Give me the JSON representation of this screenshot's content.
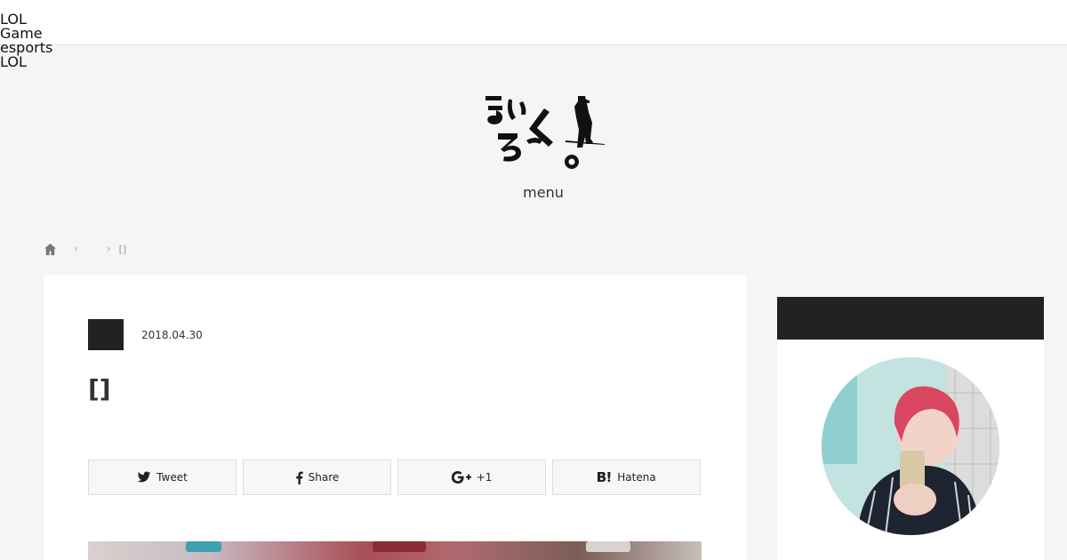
{
  "topnav": {
    "items": [
      "LOL",
      "Game",
      "esports",
      "LOL"
    ]
  },
  "header": {
    "logo_alt": "site logo",
    "menu_label": "menu"
  },
  "breadcrumb": {
    "home_icon": "home-icon",
    "items": [
      "",
      "[]"
    ]
  },
  "article": {
    "date": "2018.04.30",
    "title": "[]",
    "share": [
      {
        "label": "Tweet",
        "icon": "twitter-icon"
      },
      {
        "label": "Share",
        "icon": "facebook-icon"
      },
      {
        "label": "+1",
        "icon": "google-plus-icon"
      },
      {
        "label": "Hatena",
        "icon": "hatena-icon"
      }
    ]
  },
  "colors": {
    "background": "#f5f5f5",
    "dark": "#222222",
    "card": "#ffffff"
  }
}
